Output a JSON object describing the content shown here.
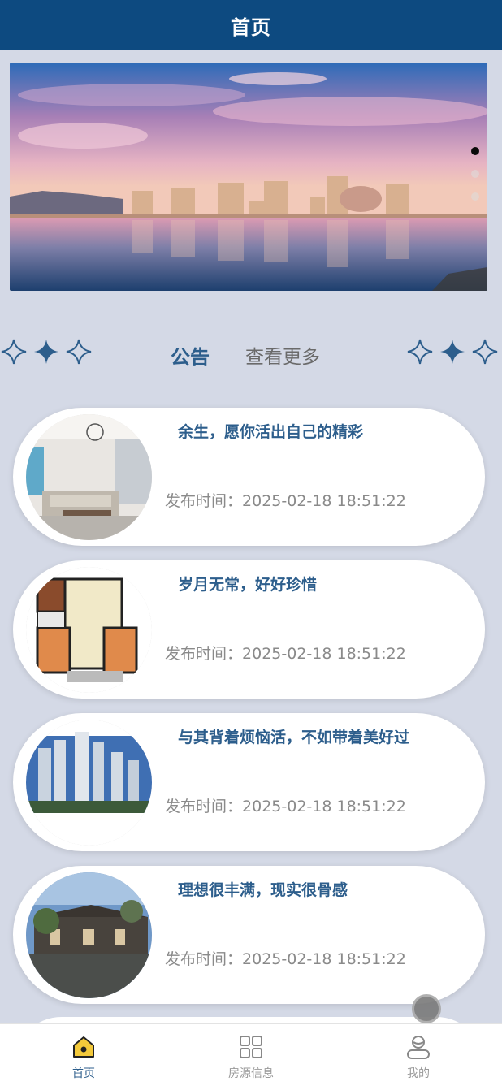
{
  "header": {
    "title": "首页"
  },
  "banner": {
    "slide_count": 3,
    "active_index": 0
  },
  "notice": {
    "title": "公告",
    "more_label": "查看更多"
  },
  "articles": [
    {
      "title": "余生，愿你活出自己的精彩",
      "time_label": "发布时间：",
      "time": "2025-02-18 18:51:22",
      "thumb": "living-room"
    },
    {
      "title": "岁月无常，好好珍惜",
      "time_label": "发布时间：",
      "time": "2025-02-18 18:51:22",
      "thumb": "floor-plan"
    },
    {
      "title": "与其背着烦恼活，不如带着美好过",
      "time_label": "发布时间：",
      "time": "2025-02-18 18:51:22",
      "thumb": "high-rise"
    },
    {
      "title": "理想很丰满，现实很骨感",
      "time_label": "发布时间：",
      "time": "2025-02-18 18:51:22",
      "thumb": "courtyard"
    }
  ],
  "tabbar": {
    "items": [
      {
        "label": "首页",
        "icon": "home-icon",
        "active": true
      },
      {
        "label": "房源信息",
        "icon": "grid-icon",
        "active": false
      },
      {
        "label": "我的",
        "icon": "user-icon",
        "active": false
      }
    ]
  },
  "colors": {
    "header": "#0d4a80",
    "accent": "#2d5e8c",
    "background": "#d4d9e6"
  }
}
